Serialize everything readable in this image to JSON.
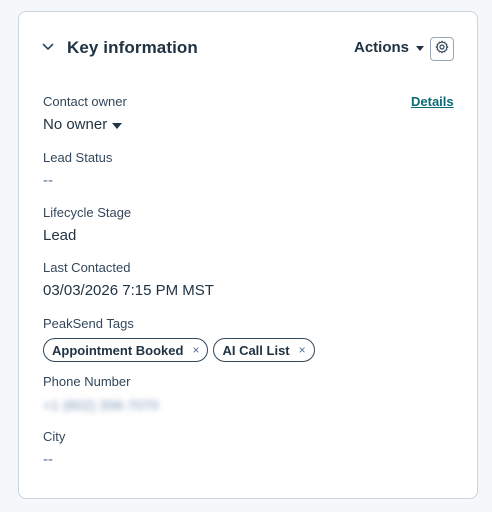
{
  "card": {
    "title": "Key information",
    "actions_label": "Actions",
    "details_link": "Details"
  },
  "fields": {
    "contact_owner": {
      "label": "Contact owner",
      "value": "No owner"
    },
    "lead_status": {
      "label": "Lead Status",
      "value": "--"
    },
    "lifecycle_stage": {
      "label": "Lifecycle Stage",
      "value": "Lead"
    },
    "last_contacted": {
      "label": "Last Contacted",
      "value": "03/03/2026 7:15 PM MST"
    },
    "peaksend_tags": {
      "label": "PeakSend Tags",
      "tags": [
        {
          "label": "Appointment Booked",
          "remove": "×"
        },
        {
          "label": "AI Call List",
          "remove": "×"
        }
      ]
    },
    "phone_number": {
      "label": "Phone Number",
      "value": "+1 (602) 356-7070"
    },
    "city": {
      "label": "City",
      "value": "--"
    }
  },
  "icons": {
    "collapse": "chevron-down-icon",
    "settings": "gear-icon",
    "remove_tag": "close-icon"
  },
  "colors": {
    "link": "#0b6b74",
    "text_dark": "#213343",
    "text": "#33475b",
    "border": "#cbd6e2"
  }
}
